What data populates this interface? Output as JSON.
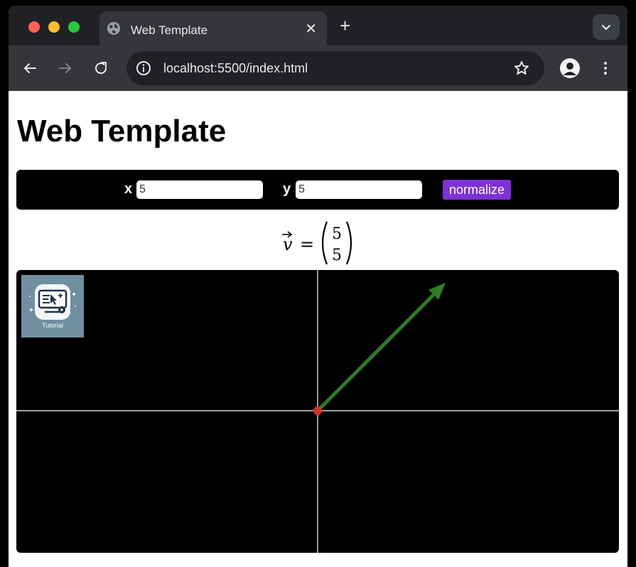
{
  "browser": {
    "tab_title": "Web Template",
    "url": "localhost:5500/index.html"
  },
  "page": {
    "heading": "Web Template",
    "controls": {
      "x_label": "x",
      "x_value": "5",
      "y_label": "y",
      "y_value": "5",
      "normalize_label": "normalize"
    },
    "vector_name": "v",
    "vector": {
      "x": 5,
      "y": 5
    },
    "tutorial_label": "Tutorial"
  },
  "colors": {
    "vector_arrow": "#2f7d24",
    "origin_dot": "#d0342c",
    "axis": "#ffffff",
    "button_bg": "#7e32d3"
  },
  "icons": [
    "globe-icon",
    "close-icon",
    "plus-icon",
    "chevron-down-icon",
    "back-arrow-icon",
    "forward-arrow-icon",
    "reload-icon",
    "info-icon",
    "star-icon",
    "profile-icon",
    "more-vertical-icon",
    "tutorial-icon"
  ]
}
